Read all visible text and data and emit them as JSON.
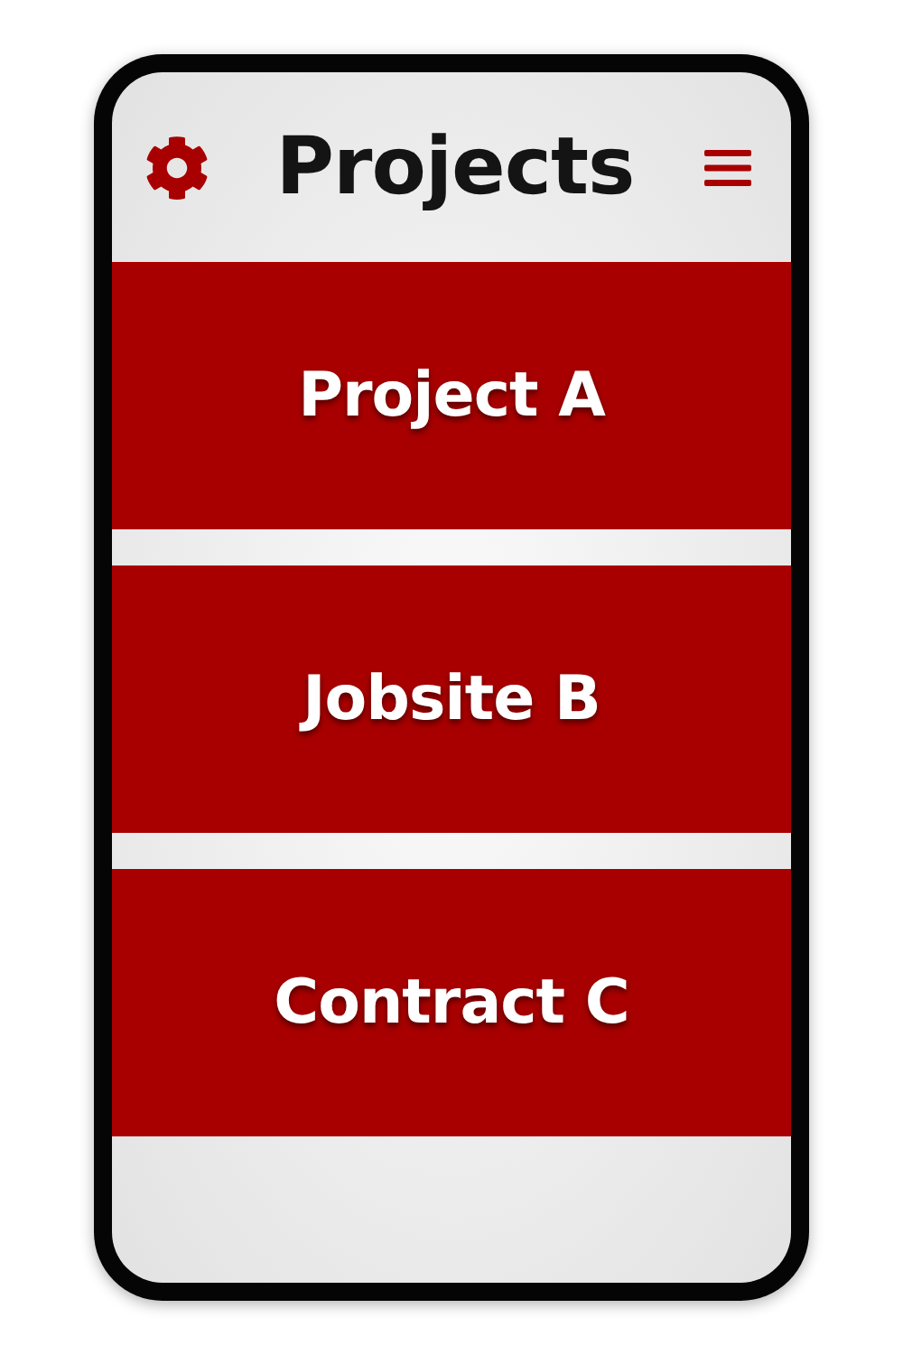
{
  "header": {
    "title": "Projects"
  },
  "projects": [
    {
      "name": "Project A"
    },
    {
      "name": "Jobsite B"
    },
    {
      "name": "Contract C"
    }
  ]
}
